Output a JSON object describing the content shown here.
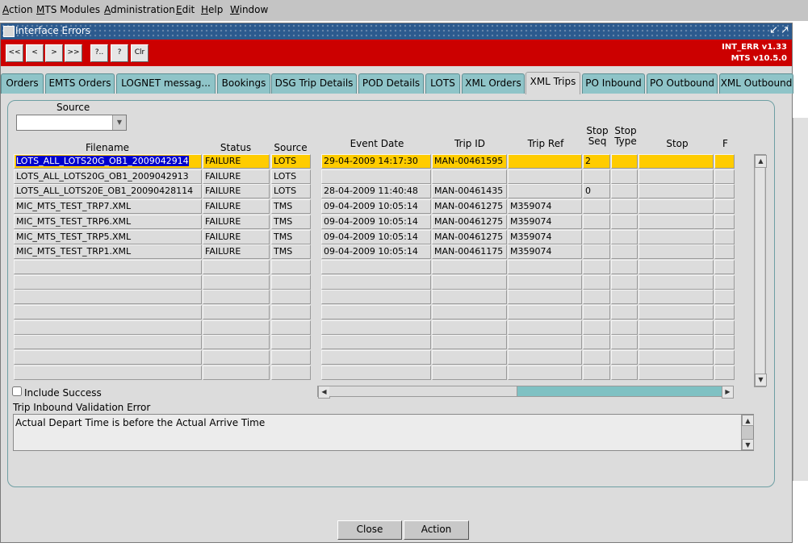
{
  "menubar": {
    "items": [
      "Action",
      "MTS Modules",
      "Administration",
      "Edit",
      "Help",
      "Window"
    ]
  },
  "window": {
    "title": "Interface Errors",
    "version_line1": "INT_ERR v1.33",
    "version_line2": "MTS v10.5.0"
  },
  "toolbar": {
    "buttons": [
      "<<",
      "<",
      ">",
      ">>",
      "?..",
      "?",
      "Clr"
    ]
  },
  "tabs": [
    {
      "label": "Orders"
    },
    {
      "label": "EMTS Orders"
    },
    {
      "label": "LOGNET messag..."
    },
    {
      "label": "Bookings"
    },
    {
      "label": "DSG Trip Details"
    },
    {
      "label": "POD Details"
    },
    {
      "label": "LOTS"
    },
    {
      "label": "XML Orders"
    },
    {
      "label": "XML Trips"
    },
    {
      "label": "PO Inbound"
    },
    {
      "label": "PO Outbound"
    },
    {
      "label": "XML Outbound"
    }
  ],
  "active_tab": "XML Trips",
  "form": {
    "source_label": "Source",
    "source_value": "",
    "include_success_label": "Include Success",
    "include_success_checked": false,
    "error_label": "Trip Inbound Validation Error",
    "error_text": "Actual Depart Time is before the Actual Arrive Time"
  },
  "left_table": {
    "headers": [
      "Filename",
      "Status",
      "Source"
    ],
    "rows": [
      [
        "LOTS_ALL_LOTS20G_OB1_2009042914",
        "FAILURE",
        "LOTS"
      ],
      [
        "LOTS_ALL_LOTS20G_OB1_2009042913",
        "FAILURE",
        "LOTS"
      ],
      [
        "LOTS_ALL_LOTS20E_OB1_20090428114",
        "FAILURE",
        "LOTS"
      ],
      [
        "MIC_MTS_TEST_TRP7.XML",
        "FAILURE",
        "TMS"
      ],
      [
        "MIC_MTS_TEST_TRP6.XML",
        "FAILURE",
        "TMS"
      ],
      [
        "MIC_MTS_TEST_TRP5.XML",
        "FAILURE",
        "TMS"
      ],
      [
        "MIC_MTS_TEST_TRP1.XML",
        "FAILURE",
        "TMS"
      ]
    ]
  },
  "right_table": {
    "headers": [
      "Event Date",
      "Trip ID",
      "Trip Ref",
      "Stop\nSeq",
      "Stop\nType",
      "Stop",
      "F"
    ],
    "rows": [
      [
        "29-04-2009 14:17:30",
        "MAN-00461595",
        "",
        "2",
        "",
        "",
        ""
      ],
      [
        "",
        "",
        "",
        "",
        "",
        "",
        ""
      ],
      [
        "28-04-2009 11:40:48",
        "MAN-00461435",
        "",
        "0",
        "",
        "",
        ""
      ],
      [
        "09-04-2009 10:05:14",
        "MAN-00461275",
        "M359074",
        "",
        "",
        "",
        ""
      ],
      [
        "09-04-2009 10:05:14",
        "MAN-00461275",
        "M359074",
        "",
        "",
        "",
        ""
      ],
      [
        "09-04-2009 10:05:14",
        "MAN-00461275",
        "M359074",
        "",
        "",
        "",
        ""
      ],
      [
        "09-04-2009 10:05:14",
        "MAN-00461175",
        "M359074",
        "",
        "",
        "",
        ""
      ]
    ]
  },
  "buttons": {
    "close": "Close",
    "action": "Action"
  },
  "colors": {
    "toolbar_red": "#cc0000",
    "tab_teal": "#8fc4c8",
    "highlight_yellow": "#ffcc00",
    "selection_blue": "#0000cc"
  }
}
